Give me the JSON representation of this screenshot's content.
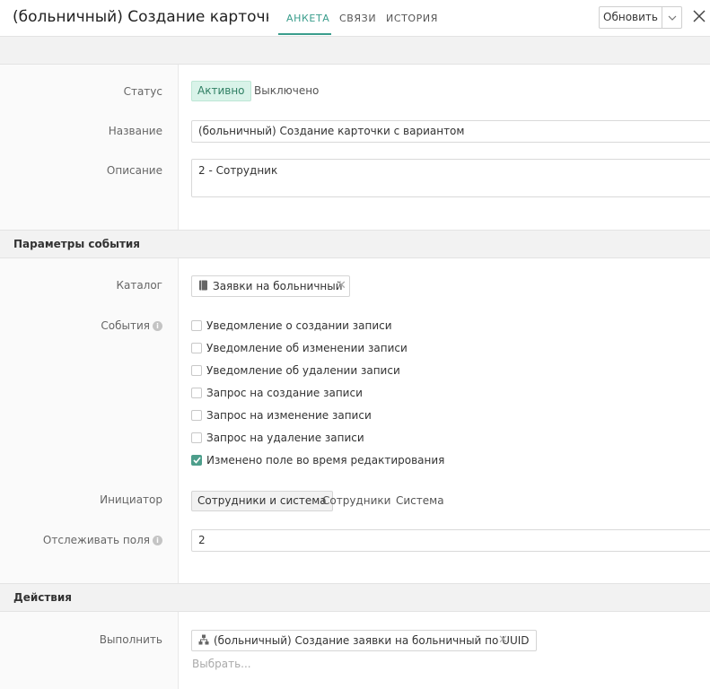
{
  "header": {
    "title": "(больничный) Создание карточки с",
    "tabs": [
      {
        "label": "АНКЕТА",
        "active": true
      },
      {
        "label": "СВЯЗИ",
        "active": false
      },
      {
        "label": "ИСТОРИЯ",
        "active": false
      }
    ],
    "update_label": "Обновить",
    "accent_color": "#3a9d8c"
  },
  "main": {
    "status": {
      "label": "Статус",
      "options": [
        "Активно",
        "Выключено"
      ],
      "selected": "Активно"
    },
    "name": {
      "label": "Название",
      "value": "(больничный) Создание карточки с вариантом"
    },
    "description": {
      "label": "Описание",
      "value": "2 - Сотрудник"
    }
  },
  "event_params": {
    "section_title": "Параметры события",
    "catalog": {
      "label": "Каталог",
      "value": "Заявки на больничный",
      "icon": "book-icon"
    },
    "events": {
      "label": "События",
      "items": [
        {
          "label": "Уведомление о создании записи",
          "checked": false
        },
        {
          "label": "Уведомление об изменении записи",
          "checked": false
        },
        {
          "label": "Уведомление об удалении записи",
          "checked": false
        },
        {
          "label": "Запрос на создание записи",
          "checked": false
        },
        {
          "label": "Запрос на изменение записи",
          "checked": false
        },
        {
          "label": "Запрос на удаление записи",
          "checked": false
        },
        {
          "label": "Изменено поле во время редактирования",
          "checked": true
        }
      ]
    },
    "initiator": {
      "label": "Инициатор",
      "options": [
        "Сотрудники и система",
        "Сотрудники",
        "Система"
      ],
      "selected": "Сотрудники и система"
    },
    "track_fields": {
      "label": "Отслеживать поля",
      "value": "2"
    }
  },
  "actions": {
    "section_title": "Действия",
    "execute": {
      "label": "Выполнить",
      "value": "(больничный) Создание заявки на больничный по UUID",
      "icon": "workflow-icon",
      "placeholder": "Выбрать..."
    }
  }
}
